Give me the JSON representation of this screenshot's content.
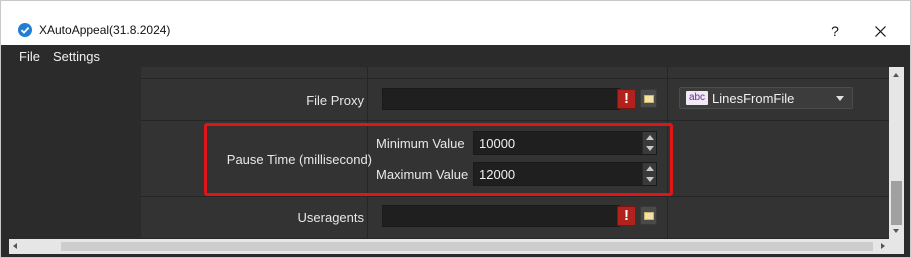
{
  "window": {
    "title": "XAutoAppeal(31.8.2024)",
    "help_label": "?",
    "close_icon": "close-icon",
    "accent_color": "#1f7fd6"
  },
  "menu": {
    "items": [
      "File",
      "Settings"
    ]
  },
  "rows": {
    "file_proxy": {
      "label": "File Proxy",
      "value": "",
      "warning_label": "!",
      "combo_tag": "abc",
      "combo_value": "LinesFromFile"
    },
    "pause_time": {
      "label": "Pause Time (millisecond)",
      "min_label": "Minimum Value",
      "min_value": "10000",
      "max_label": "Maximum Value",
      "max_value": "12000"
    },
    "useragents": {
      "label": "Useragents",
      "value": "",
      "warning_label": "!"
    }
  },
  "colors": {
    "highlight": "#e0151a",
    "warning": "#b1221c"
  }
}
